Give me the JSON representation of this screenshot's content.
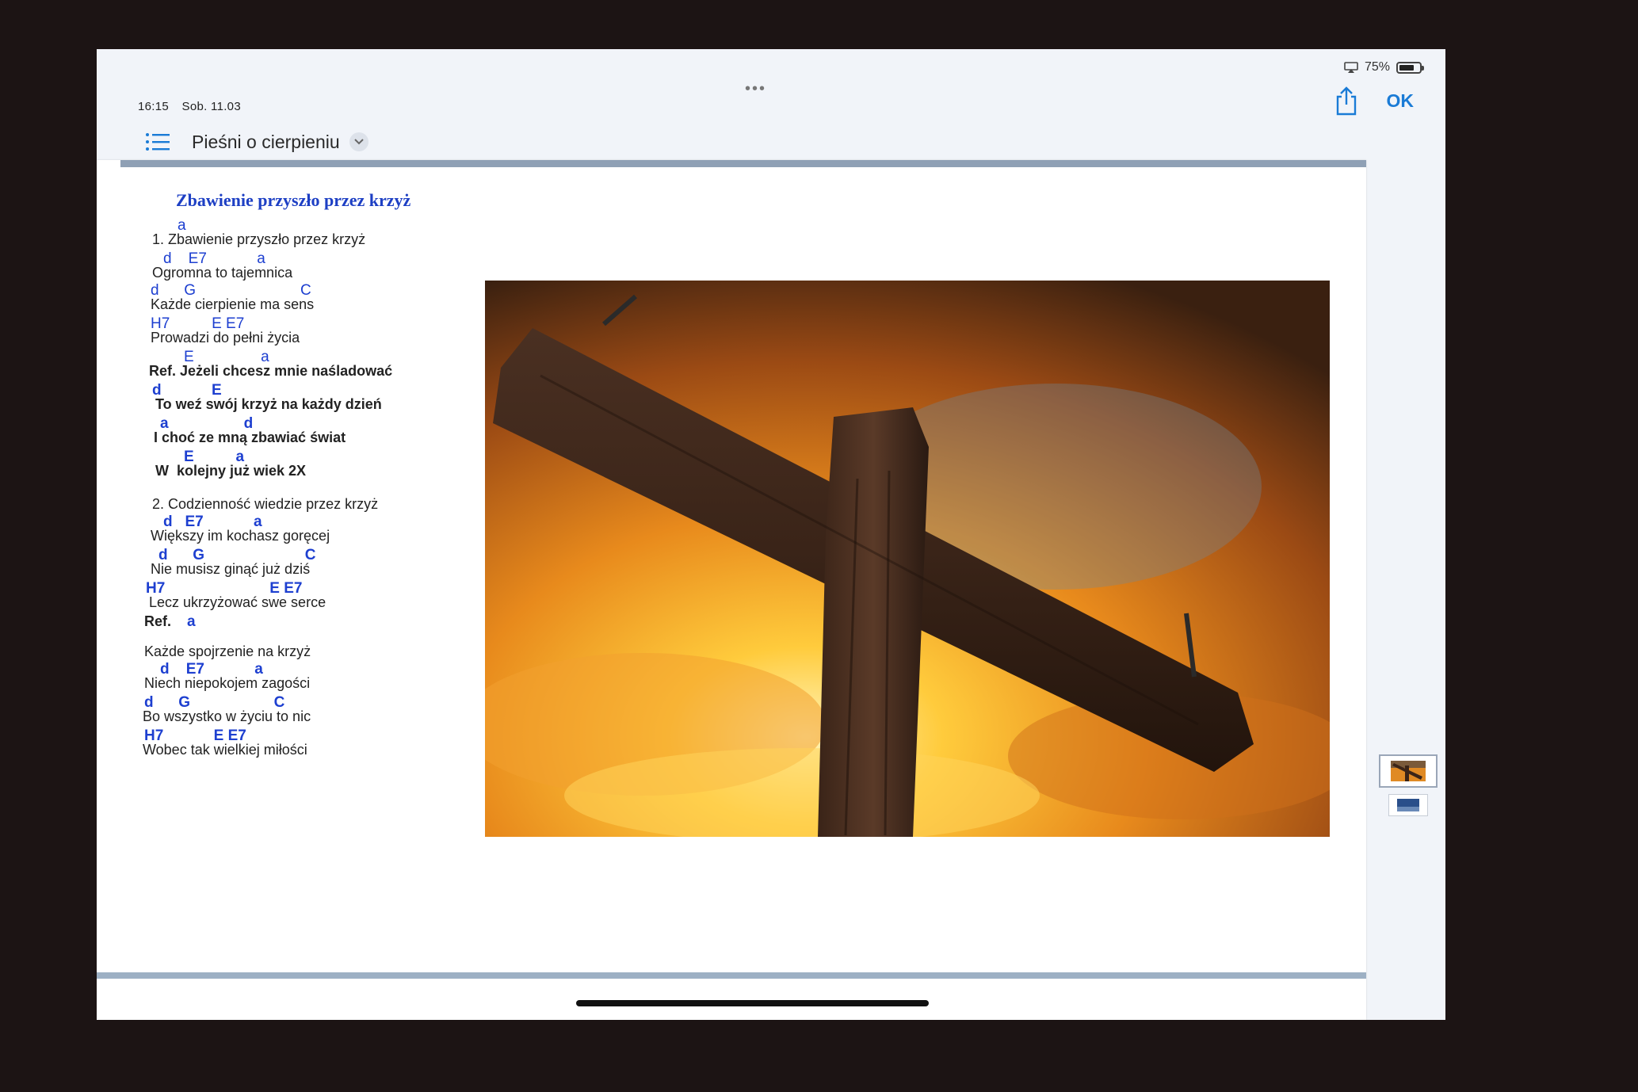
{
  "status": {
    "time": "16:15",
    "date": "Sob. 11.03",
    "battery": "75%",
    "battery_level": 0.75
  },
  "toolbar": {
    "title": "Pieśni o cierpieniu",
    "ok_label": "OK"
  },
  "song": {
    "title": "Zbawienie przyszło przez krzyż",
    "lines": [
      {
        "type": "chord",
        "text": "a"
      },
      {
        "type": "lyric",
        "text": "1. Zbawienie przyszło przez krzyż"
      },
      {
        "type": "chord",
        "text": "d    E7            a"
      },
      {
        "type": "lyric",
        "text": "Ogromna to tajemnica"
      },
      {
        "type": "chord",
        "text": "d      G                         C"
      },
      {
        "type": "lyric",
        "text": "Każde cierpienie ma sens"
      },
      {
        "type": "chord",
        "text": "H7          E E7"
      },
      {
        "type": "lyric",
        "text": "Prowadzi do pełni życia"
      },
      {
        "type": "chord",
        "text": "E                a"
      },
      {
        "type": "lyric-bold",
        "text": "Ref. Jeżeli chcesz mnie naśladować"
      },
      {
        "type": "chord-bold",
        "text": "d            E"
      },
      {
        "type": "lyric-bold",
        "text": "To weź swój krzyż na każdy dzień"
      },
      {
        "type": "chord-bold",
        "text": "a                  d"
      },
      {
        "type": "lyric-bold",
        "text": "I choć ze mną zbawiać świat"
      },
      {
        "type": "chord-bold",
        "text": "E          a"
      },
      {
        "type": "lyric-bold",
        "text": "W  kolejny już wiek 2X"
      },
      {
        "type": "lyric",
        "text": "2. Codzienność wiedzie przez krzyż"
      },
      {
        "type": "chord-bold",
        "text": "d   E7            a"
      },
      {
        "type": "lyric",
        "text": "Większy im kochasz goręcej"
      },
      {
        "type": "chord-bold",
        "text": "d      G                        C"
      },
      {
        "type": "lyric",
        "text": "Nie musisz ginąć już dziś"
      },
      {
        "type": "chord-bold",
        "text": "H7                         E E7"
      },
      {
        "type": "lyric",
        "text": "Lecz ukrzyżować swe serce"
      },
      {
        "type": "ref",
        "text": "Ref.",
        "chord": "a"
      },
      {
        "type": "lyric",
        "text": "Każde spojrzenie na krzyż"
      },
      {
        "type": "chord-bold",
        "text": "d    E7            a"
      },
      {
        "type": "lyric",
        "text": "Niech niepokojem zagości"
      },
      {
        "type": "chord-bold",
        "text": "d      G                    C"
      },
      {
        "type": "lyric",
        "text": "Bo wszystko w życiu to nic"
      },
      {
        "type": "chord-bold",
        "text": "H7            E E7"
      },
      {
        "type": "lyric",
        "text": "Wobec tak wielkiej miłości"
      }
    ]
  },
  "colors": {
    "accent": "#1a7bd6",
    "chord": "#1d3fd0",
    "title": "#1d3fc4",
    "band": "#8fa0b5"
  },
  "icons": [
    "list-icon",
    "chevron-down-icon",
    "share-icon",
    "airplay-icon",
    "battery-icon"
  ]
}
